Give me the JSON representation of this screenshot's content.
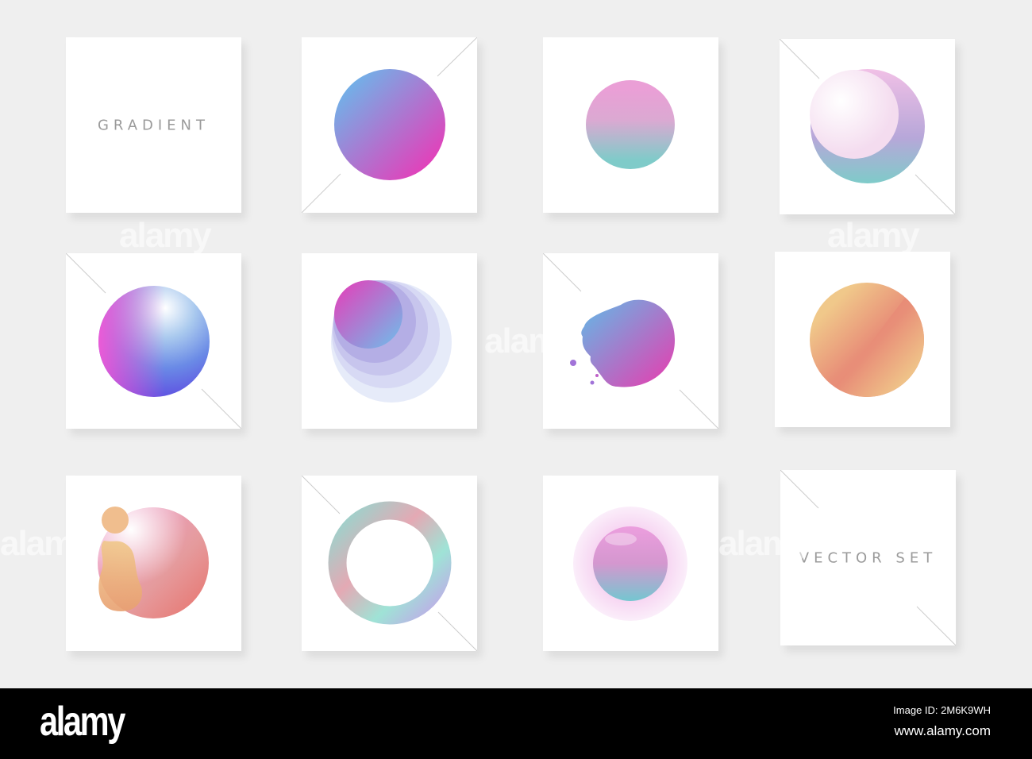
{
  "cards": {
    "title_label": "GRADIENT",
    "subtitle_label": "VECTOR SET"
  },
  "watermark": "alamy",
  "footer": {
    "logo": "alamy",
    "image_id": "Image ID: 2M6K9WH",
    "website": "www.alamy.com"
  },
  "colors": {
    "background": "#efefef",
    "card": "#ffffff",
    "footer": "#000000",
    "pink": "#e83bb8",
    "blue": "#6cb6ea",
    "teal": "#7fcbc9",
    "peach": "#f0c88a",
    "coral": "#e8716a"
  }
}
